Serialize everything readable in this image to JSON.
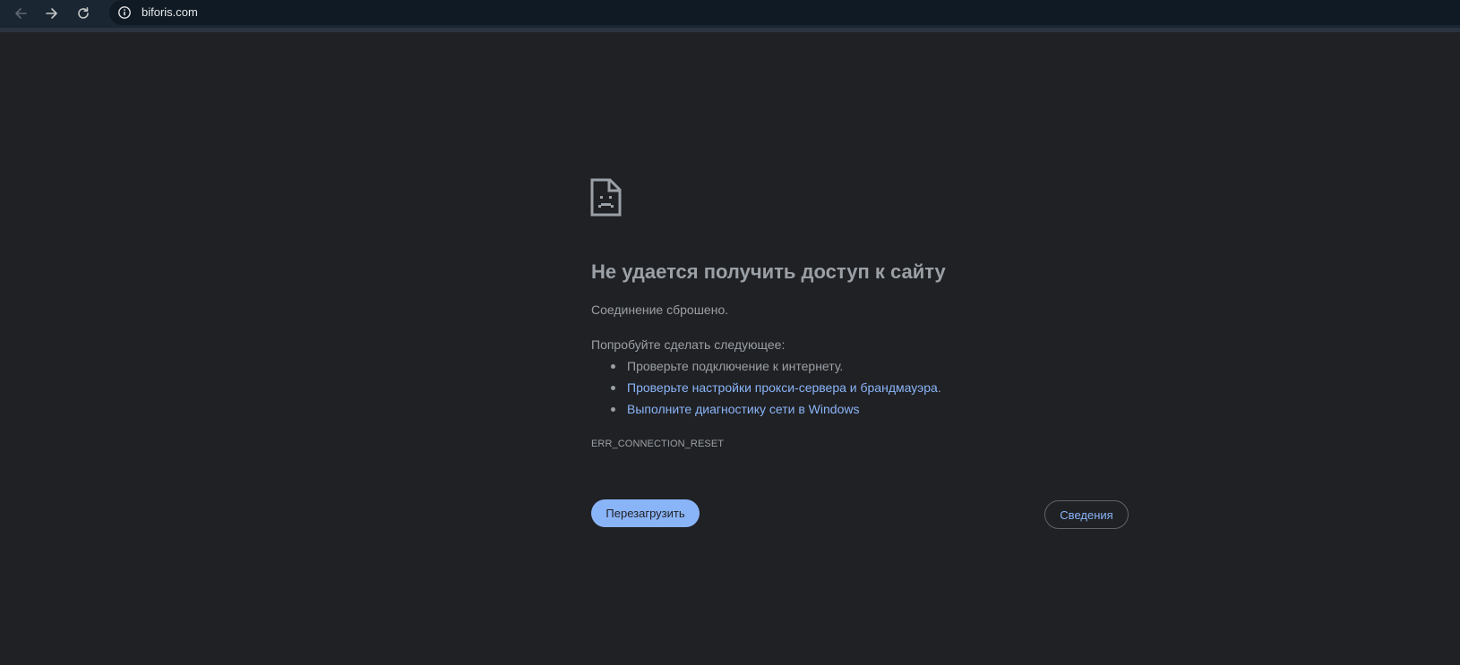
{
  "browser": {
    "url": "biforis.com",
    "icons": {
      "back": "arrow-left-icon",
      "forward": "arrow-right-icon",
      "reload": "reload-icon",
      "site_info": "info-icon"
    }
  },
  "error_page": {
    "icon": "sad-file-icon",
    "heading": "Не удается получить доступ к сайту",
    "summary": "Соединение сброшено.",
    "suggestions_intro": "Попробуйте сделать следующее:",
    "suggestions": [
      {
        "text": "Проверьте подключение к интернету.",
        "link": false
      },
      {
        "text": "Проверьте настройки прокси-сервера и брандмауэра",
        "suffix": ".",
        "link": true
      },
      {
        "text": "Выполните диагностику сети в Windows",
        "link": true
      }
    ],
    "error_code": "ERR_CONNECTION_RESET",
    "reload_button": "Перезагрузить",
    "details_button": "Сведения"
  },
  "colors": {
    "page_background": "#202124",
    "text": "#9aa0a6",
    "link": "#8ab4f8",
    "primary_button": "#8ab4f8",
    "toolbar": "#1b2633"
  }
}
